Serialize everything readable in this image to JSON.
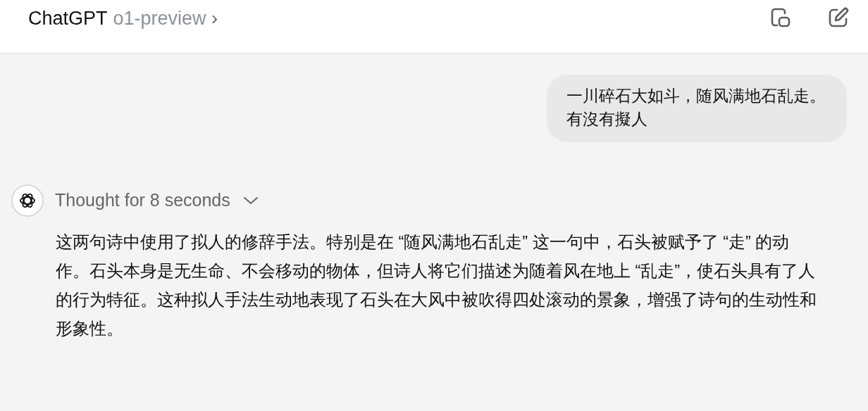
{
  "header": {
    "title": "ChatGPT",
    "model": "o1-preview",
    "model_caret": "›"
  },
  "user_message": {
    "lines": [
      "一川碎石大如斗，随风满地石乱走。",
      "有沒有擬人"
    ]
  },
  "assistant": {
    "thought": {
      "label": "Thought for 8 seconds",
      "expanded": false
    },
    "text": "这两句诗中使用了拟人的修辞手法。特别是在 “随风满地石乱走” 这一句中，石头被赋予了 “走” 的动作。石头本身是无生命、不会移动的物体，但诗人将它们描述为随着风在地上 “乱走”，使石头具有了人的行为特征。这种拟人手法生动地表现了石头在大风中被吹得四处滚动的景象，增强了诗句的生动性和形象性。"
  }
}
